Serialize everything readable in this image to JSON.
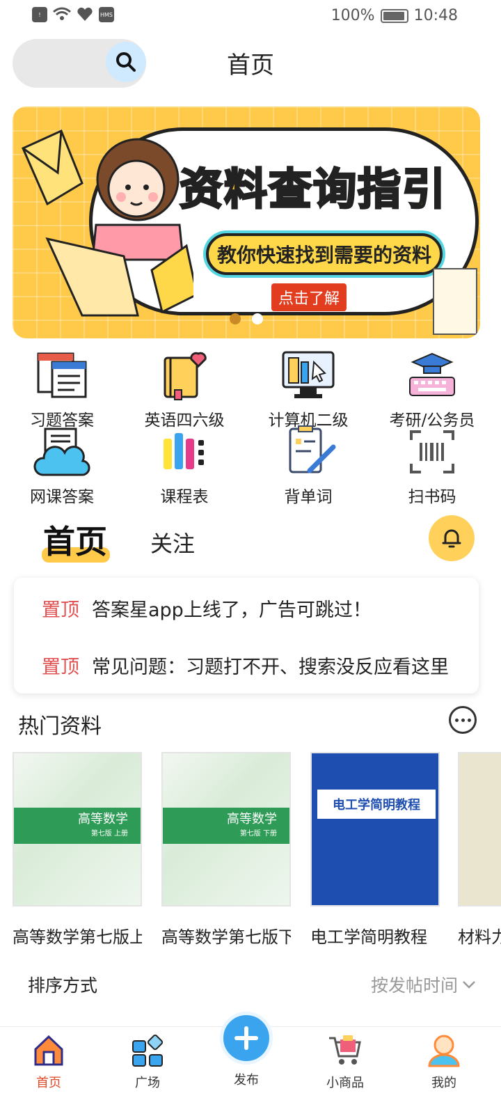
{
  "status_bar": {
    "battery": "100%",
    "time": "10:48"
  },
  "header": {
    "title": "首页"
  },
  "banner": {
    "title": "资料查询指引",
    "subtitle": "教你快速找到需要的资料",
    "button": "点击了解"
  },
  "grid": [
    {
      "label": "习题答案",
      "icon": "answers-icon"
    },
    {
      "label": "英语四六级",
      "icon": "english-book-icon"
    },
    {
      "label": "计算机二级",
      "icon": "computer-icon"
    },
    {
      "label": "考研/公务员",
      "icon": "graduate-cap-icon"
    },
    {
      "label": "网课答案",
      "icon": "cloud-doc-icon"
    },
    {
      "label": "课程表",
      "icon": "timetable-icon"
    },
    {
      "label": "背单词",
      "icon": "vocab-icon"
    },
    {
      "label": "扫书码",
      "icon": "barcode-scan-icon"
    }
  ],
  "feed_tabs": {
    "home": "首页",
    "follow": "关注"
  },
  "pinned": [
    {
      "tag": "置顶",
      "text": "答案星app上线了，广告可跳过！"
    },
    {
      "tag": "置顶",
      "text": "常见问题：习题打不开、搜索没反应看这里"
    }
  ],
  "hot": {
    "title": "热门资料",
    "books": [
      {
        "label": "高等数学第七版上册",
        "cover_title": "高等数学",
        "cover_sub": "第七版 上册"
      },
      {
        "label": "高等数学第七版下册",
        "cover_title": "高等数学",
        "cover_sub": "第七版 下册"
      },
      {
        "label": "电工学简明教程",
        "cover_title": "电工学简明教程"
      },
      {
        "label": "材料力学"
      }
    ]
  },
  "sort": {
    "label": "排序方式",
    "value": "按发帖时间"
  },
  "bottom_nav": [
    {
      "label": "首页",
      "icon": "home-icon",
      "active": true
    },
    {
      "label": "广场",
      "icon": "square-icon"
    },
    {
      "label": "发布",
      "icon": "plus-icon"
    },
    {
      "label": "小商品",
      "icon": "cart-icon"
    },
    {
      "label": "我的",
      "icon": "profile-icon"
    }
  ],
  "colors": {
    "accent": "#ffc94a",
    "active_nav": "#e24a2a",
    "pin_tag": "#e05050",
    "publish": "#3aa5ee"
  }
}
